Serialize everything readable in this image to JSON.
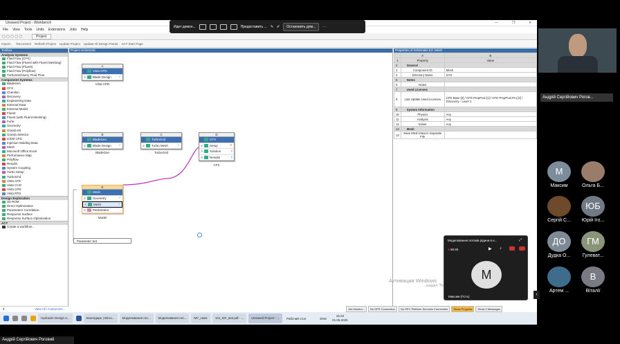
{
  "window": {
    "title": "Unsaved Project - Workbench"
  },
  "menu": [
    "File",
    "View",
    "Tools",
    "Units",
    "Extensions",
    "Jobs",
    "Help"
  ],
  "tab": "Project",
  "toolbar": [
    "Import...",
    "Reconnect",
    "Refresh Project",
    "Update Project",
    "Update All Design Points",
    "ACT Start Page"
  ],
  "toolbox": {
    "title": "Toolbox",
    "sections": [
      {
        "name": "Analysis Systems",
        "items": [
          "Fluid Flow (CFX)",
          "Fluid Flow (Fluent with Fluent Meshing)",
          "Fluid Flow (Fluent)",
          "Fluid Flow (Polyflow)",
          "Turbomachinery Fluid Flow"
        ]
      },
      {
        "name": "Component Systems",
        "items": [
          "BladeGen",
          "CFX",
          "Chemkin",
          "Discovery",
          "Engineering Data",
          "External Data",
          "External Model",
          "Fluent",
          "Fluent (with Fluent Meshing)",
          "Forte",
          "Geometry",
          "Granta MI",
          "Granta Selector",
          "ICEM CFD",
          "Injection Molding Data",
          "Mesh",
          "Microsoft Office Excel",
          "Performance Map",
          "Polyflow",
          "Results",
          "System Coupling",
          "Turbo Setup",
          "TurboGrid",
          "Vista AFD",
          "Vista CCD",
          "Vista CPD",
          "Vista RTD"
        ]
      },
      {
        "name": "Design Exploration",
        "items": [
          "3D ROM",
          "Direct Optimization",
          "Parameters Correlation",
          "Response Surface",
          "Response Surface Optimization"
        ]
      },
      {
        "name": "ACT",
        "items": [
          "Create a workflow..."
        ]
      }
    ],
    "footer_filter": "▼",
    "footer_link": "View All / Customize..."
  },
  "schematic": {
    "title": "Project Schematic",
    "systems": [
      {
        "letter": "A",
        "rows": [
          "Vista CPD",
          "Blade Design"
        ],
        "label": "Vista CPD"
      },
      {
        "letter": "B",
        "rows": [
          "BladeGen",
          "Blade Design"
        ],
        "label": "BladeGen"
      },
      {
        "letter": "C",
        "rows": [
          "TurboGrid",
          "Turbo Mesh"
        ],
        "label": "TurboGrid"
      },
      {
        "letter": "D",
        "rows": [
          "CFX",
          "Setup",
          "Solution",
          "Results"
        ],
        "label": "CFX"
      },
      {
        "letter": "E",
        "rows": [
          "Mesh",
          "Geometry",
          "Mesh",
          "Parameters"
        ],
        "label": "Model"
      }
    ],
    "param_set": "Parameter Set"
  },
  "props": {
    "title": "Properties of Schematic E3: Mesh",
    "col_a": "A",
    "col_b": "B",
    "head_prop": "Property",
    "head_val": "Value",
    "rows": [
      {
        "n": "1",
        "a": "Property",
        "b": "Value",
        "kind": "hdr"
      },
      {
        "n": "2",
        "a": "General",
        "b": "",
        "kind": "cat"
      },
      {
        "n": "3",
        "a": "Component ID",
        "b": "Mesh",
        "kind": "row"
      },
      {
        "n": "4",
        "a": "Directory Name",
        "b": "SYS",
        "kind": "row"
      },
      {
        "n": "5",
        "a": "Notes",
        "b": "",
        "kind": "cat"
      },
      {
        "n": "6",
        "a": "Notes",
        "b": "",
        "kind": "row"
      },
      {
        "n": "7",
        "a": "Used Licenses",
        "b": "",
        "kind": "cat"
      },
      {
        "n": "8",
        "a": "Last Update Used Licenses",
        "b": "CFD Base [2] / CFD PrepPost [1] / CFD PrepPost Pro [2] / Discovery - Level 1",
        "kind": "tall"
      },
      {
        "n": "9",
        "a": "System Information",
        "b": "",
        "kind": "cat"
      },
      {
        "n": "10",
        "a": "Physics",
        "b": "Any",
        "kind": "row"
      },
      {
        "n": "11",
        "a": "Analysis",
        "b": "Any",
        "kind": "row"
      },
      {
        "n": "12",
        "a": "Solver",
        "b": "Any",
        "kind": "row"
      },
      {
        "n": "13",
        "a": "Mesh",
        "b": "",
        "kind": "cat"
      },
      {
        "n": "14",
        "a": "Save Mesh Data in Separate File",
        "b": "",
        "kind": "row"
      }
    ]
  },
  "status": [
    "Job Monitor...",
    "No DPS Connection",
    "No HPC Platform Services Connection",
    "Show Progress",
    "Show 0 Messages"
  ],
  "watermark": {
    "line1": "Активация Windows",
    "line2": "...раздел \"Параметры\"."
  },
  "taskbar": {
    "apps": [
      "Hydraulic Design a...",
      "Календарь | Micro...",
      "Моделювання пот...",
      "Моделювання пот...",
      "МУ_сем1",
      "131_МУ_вс6.pdf - ...",
      "Unsaved Project - ..."
    ],
    "desktop": "Рабочий стол",
    "lang": "ENG",
    "time": "15:23",
    "date": "01.05.2025"
  },
  "zoom": {
    "sharing": "Идет демон...",
    "provide": "Предоставить ...",
    "stop": "Остановить дем..."
  },
  "meeting": {
    "presenter": "Андрій Сергійович Роговий",
    "presenter_short": "Андрій Сергійович Рогов...",
    "participants": [
      {
        "initials": "М",
        "name": "Максим",
        "color": "#7c8c9a"
      },
      {
        "initials": "",
        "name": "Ольга Б...",
        "color": "#9a7c6a"
      },
      {
        "initials": "",
        "name": "Сергій С...",
        "color": "#6d4a2c"
      },
      {
        "initials": "ЮБ",
        "name": "Юрій Іго...",
        "color": "#6f7a84"
      },
      {
        "initials": "ДО",
        "name": "Дудка О...",
        "color": "#7d8a96"
      },
      {
        "initials": "ГМ",
        "name": "Гулеват...",
        "color": "#8a9478"
      },
      {
        "initials": "",
        "name": "Артем ...",
        "color": "#3d6d8a"
      },
      {
        "initials": "В",
        "name": "Віталії",
        "color": "#7a7a84"
      }
    ],
    "popup": {
      "title": "Моделювання потоків рідини в н...",
      "time": "50:45",
      "avatar": "М",
      "caption": "Максим (Гість)"
    }
  }
}
